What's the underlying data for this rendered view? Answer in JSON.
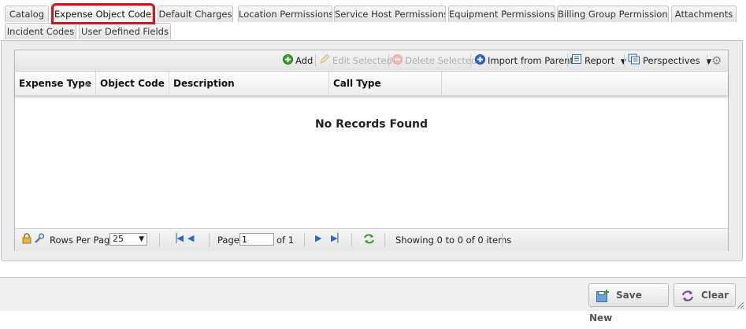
{
  "tabs": {
    "row1": [
      "Catalog",
      "Expense Object Codes",
      "Default Charges",
      "Location Permissions",
      "Service Host Permissions",
      "Equipment Permissions",
      "Billing Group Permissions",
      "Attachments"
    ],
    "row2": [
      "Incident Codes",
      "User Defined Fields"
    ],
    "active": "Expense Object Codes"
  },
  "toolbar": {
    "add": "Add",
    "edit_selected": "Edit Selected",
    "delete_selected": "Delete Selected",
    "import_from_parent": "Import from Parent",
    "report": "Report",
    "perspectives": "Perspectives"
  },
  "grid": {
    "columns": [
      "Expense Type",
      "Object Code",
      "Description",
      "Call Type"
    ],
    "empty_message": "No Records Found"
  },
  "pager": {
    "rows_per_page_label": "Rows Per Page:",
    "rows_per_page_value": "25",
    "page_label": "Page:",
    "page_value": "1",
    "of_label": "of 1",
    "status": "Showing 0 to 0 of 0 items"
  },
  "footer": {
    "save_new": "Save New",
    "clear": "Clear"
  },
  "colors": {
    "active_tab_highlight": "#d0171e",
    "link_blue": "#2a68c9",
    "add_green": "#3a9a2a"
  }
}
